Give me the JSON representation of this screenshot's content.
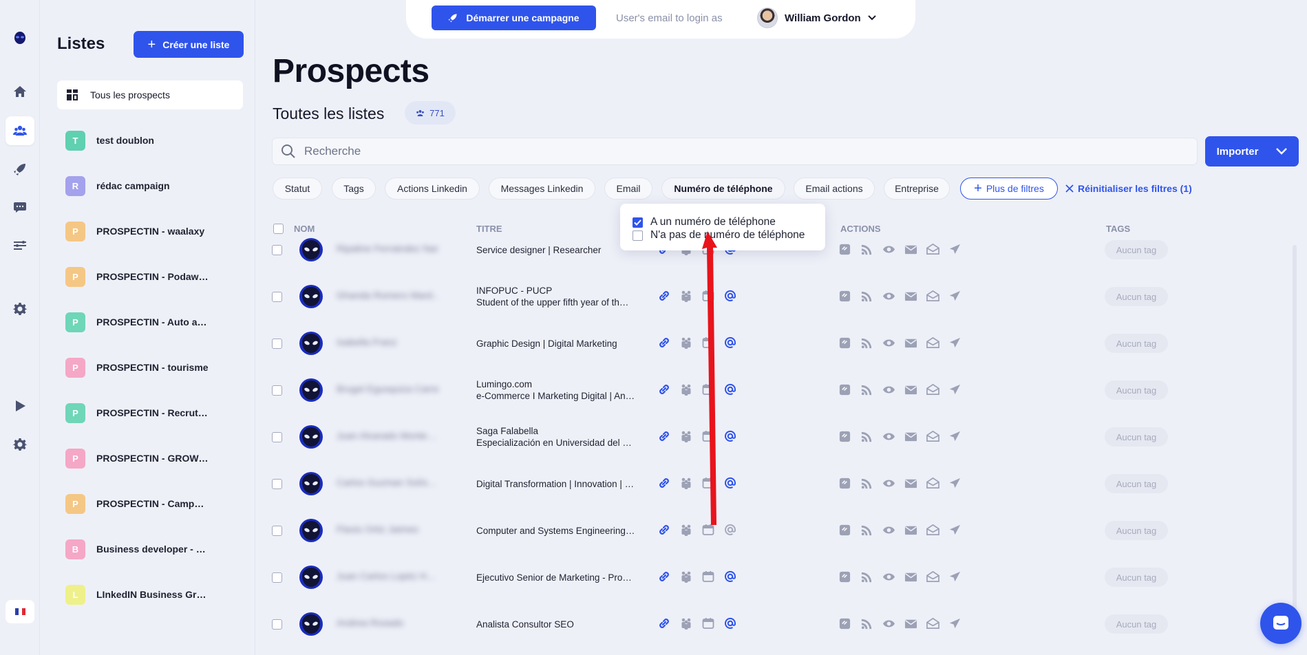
{
  "topbar": {
    "campaign_button": "Démarrer une campagne",
    "login_as": "User's email to login as",
    "user_name": "William Gordon"
  },
  "sidebar": {
    "title": "Listes",
    "create_button": "Créer une liste",
    "all_prospects": "Tous les prospects",
    "items": [
      {
        "letter": "T",
        "label": "test doublon",
        "color": "#5fd0b0"
      },
      {
        "letter": "R",
        "label": "rédac campaign",
        "color": "#a4a2ec"
      },
      {
        "letter": "P",
        "label": "PROSPECTIN - waalaxy",
        "color": "#f5c784"
      },
      {
        "letter": "P",
        "label": "PROSPECTIN - Podaw…",
        "color": "#f5c784"
      },
      {
        "letter": "P",
        "label": "PROSPECTIN - Auto a…",
        "color": "#6fd6b8"
      },
      {
        "letter": "P",
        "label": "PROSPECTIN - tourisme",
        "color": "#f5a7c6"
      },
      {
        "letter": "P",
        "label": "PROSPECTIN - Recrut…",
        "color": "#6fd6b8"
      },
      {
        "letter": "P",
        "label": "PROSPECTIN - GROW…",
        "color": "#f5a7c6"
      },
      {
        "letter": "P",
        "label": "PROSPECTIN - Camp…",
        "color": "#f5c784"
      },
      {
        "letter": "B",
        "label": "Business developer - …",
        "color": "#f5a7c6"
      },
      {
        "letter": "L",
        "label": "LInkedIN Business Gr…",
        "color": "#eef08a"
      }
    ]
  },
  "main": {
    "title": "Prospects",
    "subtitle": "Toutes les listes",
    "count": "771",
    "search_placeholder": "Recherche",
    "import_button": "Importer",
    "filters": [
      "Statut",
      "Tags",
      "Actions Linkedin",
      "Messages Linkedin",
      "Email",
      "Numéro de téléphone",
      "Email actions",
      "Entreprise"
    ],
    "more_filters": "Plus de filtres",
    "reset_filters": "Réinitialiser les filtres (1)"
  },
  "table": {
    "headers": {
      "name": "NOM",
      "title": "TITRE",
      "actions": "ACTIONS",
      "tags": "TAGS"
    },
    "rows": [
      {
        "name": "Ripaline Fernández Nar…",
        "title1": "Service designer | Researcher",
        "title2": "",
        "tag": "Aucun tag",
        "email_active": true
      },
      {
        "name": "Ghanda Romero Mard…",
        "title1": "INFOPUC - PUCP",
        "title2": "Student of the upper fifth year of th…",
        "tag": "Aucun tag",
        "email_active": true
      },
      {
        "name": "Isabella Franz",
        "title1": "Graphic Design | Digital Marketing",
        "title2": "",
        "tag": "Aucun tag",
        "email_active": true
      },
      {
        "name": "Brugel Egusquiza Carre…",
        "title1": "Lumingo.com",
        "title2": "e-Commerce I Marketing Digital | An…",
        "tag": "Aucun tag",
        "email_active": true
      },
      {
        "name": "Juan Alvarado Monte…",
        "title1": "Saga Falabella",
        "title2": "Especialización en Universidad del …",
        "tag": "Aucun tag",
        "email_active": true
      },
      {
        "name": "Carlos Guzman Solís…",
        "title1": "Digital Transformation | Innovation | …",
        "title2": "",
        "tag": "Aucun tag",
        "email_active": true
      },
      {
        "name": "Flavio Ortiz Jaimes",
        "title1": "Computer and Systems Engineering…",
        "title2": "",
        "tag": "Aucun tag",
        "email_active": false
      },
      {
        "name": "Juan Carlos Lopéz H…",
        "title1": "Ejecutivo Senior de Marketing - Pro…",
        "title2": "",
        "tag": "Aucun tag",
        "email_active": true
      },
      {
        "name": "Andrea Rosado",
        "title1": "Analista Consultor SEO",
        "title2": "",
        "tag": "Aucun tag",
        "email_active": true
      }
    ]
  },
  "phone_filter_popover": {
    "options": [
      {
        "label": "A un numéro de téléphone",
        "checked": true
      },
      {
        "label": "N'a pas de numéro de téléphone",
        "checked": false
      }
    ]
  },
  "colors": {
    "accent": "#2f54eb",
    "annotation_arrow": "#e8141c"
  }
}
